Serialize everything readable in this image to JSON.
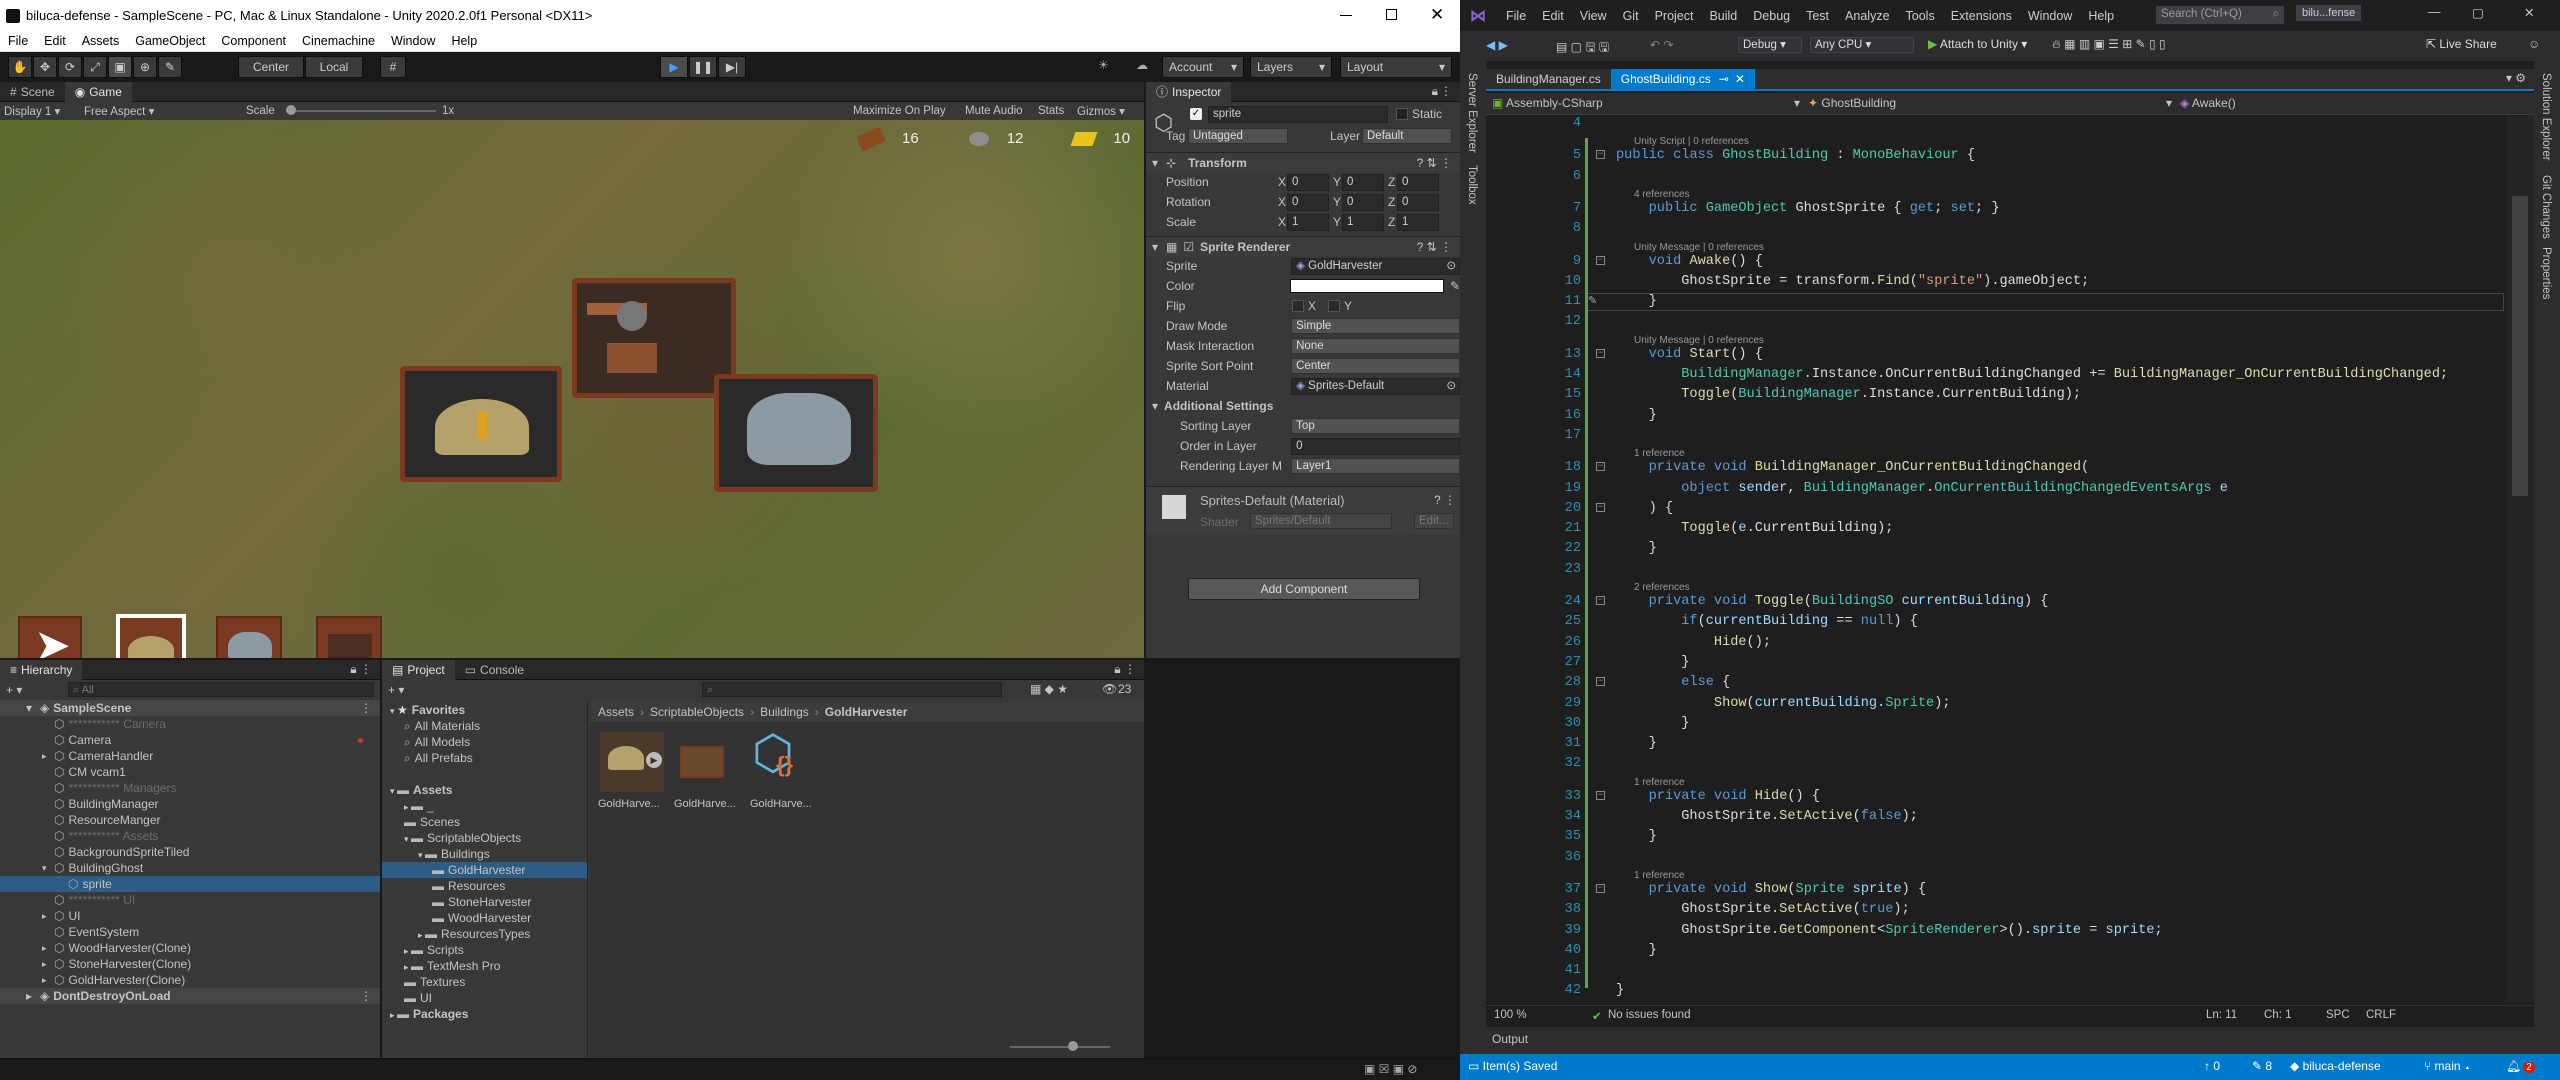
{
  "unity": {
    "window_title": "biluca-defense - SampleScene - PC, Mac & Linux Standalone - Unity 2020.2.0f1 Personal <DX11>",
    "menu": [
      "File",
      "Edit",
      "Assets",
      "GameObject",
      "Component",
      "Cinemachine",
      "Window",
      "Help"
    ],
    "toolbar": {
      "center": "Center",
      "local": "Local",
      "account": "Account",
      "layers": "Layers",
      "layout": "Layout"
    },
    "scene_tabs": [
      "Scene",
      "Game"
    ],
    "game_bar": {
      "display": "Display 1",
      "aspect": "Free Aspect",
      "scale_label": "Scale",
      "scale_value": "1x",
      "maximize": "Maximize On Play",
      "mute": "Mute Audio",
      "stats": "Stats",
      "gizmos": "Gizmos"
    },
    "resources": {
      "wood": "16",
      "stone": "12",
      "gold": "10"
    },
    "inspector": {
      "tab": "Inspector",
      "name": "sprite",
      "static": "Static",
      "tag_label": "Tag",
      "tag": "Untagged",
      "layer_label": "Layer",
      "layer": "Default",
      "transform": {
        "title": "Transform",
        "position": "Position",
        "rotation": "Rotation",
        "scale": "Scale",
        "pos": [
          "0",
          "0",
          "0"
        ],
        "rot": [
          "0",
          "0",
          "0"
        ],
        "scl": [
          "1",
          "1",
          "1"
        ]
      },
      "sprite_renderer": {
        "title": "Sprite Renderer",
        "rows": [
          {
            "label": "Sprite",
            "value": "GoldHarvester"
          },
          {
            "label": "Color",
            "value": ""
          },
          {
            "label": "Flip",
            "value": ""
          },
          {
            "label": "Draw Mode",
            "value": "Simple"
          },
          {
            "label": "Mask Interaction",
            "value": "None"
          },
          {
            "label": "Sprite Sort Point",
            "value": "Center"
          },
          {
            "label": "Material",
            "value": "Sprites-Default"
          }
        ],
        "flip_x": "X",
        "flip_y": "Y",
        "additional": "Additional Settings",
        "sorting_layer_label": "Sorting Layer",
        "sorting_layer": "Top",
        "order_label": "Order in Layer",
        "order": "0",
        "rendering_label": "Rendering Layer M",
        "rendering": "Layer1"
      },
      "material": {
        "name": "Sprites-Default (Material)",
        "shader_label": "Shader",
        "shader": "Sprites/Default",
        "edit": "Edit..."
      },
      "add_component": "Add Component"
    },
    "hierarchy": {
      "tab": "Hierarchy",
      "search": "All",
      "items": [
        {
          "label": "SampleScene",
          "indent": 0,
          "kind": "scene"
        },
        {
          "label": "*********** Camera",
          "indent": 1,
          "kind": "dim"
        },
        {
          "label": "Camera",
          "indent": 1,
          "kind": "obj"
        },
        {
          "label": "CameraHandler",
          "indent": 1,
          "kind": "obj"
        },
        {
          "label": "CM vcam1",
          "indent": 1,
          "kind": "obj"
        },
        {
          "label": "*********** Managers",
          "indent": 1,
          "kind": "dim"
        },
        {
          "label": "BuildingManager",
          "indent": 1,
          "kind": "obj"
        },
        {
          "label": "ResourceManger",
          "indent": 1,
          "kind": "obj"
        },
        {
          "label": "*********** Assets",
          "indent": 1,
          "kind": "dim"
        },
        {
          "label": "BackgroundSpriteTiled",
          "indent": 1,
          "kind": "obj"
        },
        {
          "label": "BuildingGhost",
          "indent": 1,
          "kind": "obj"
        },
        {
          "label": "sprite",
          "indent": 2,
          "kind": "sel"
        },
        {
          "label": "*********** UI",
          "indent": 1,
          "kind": "dim"
        },
        {
          "label": "UI",
          "indent": 1,
          "kind": "obj"
        },
        {
          "label": "EventSystem",
          "indent": 1,
          "kind": "obj"
        },
        {
          "label": "WoodHarvester(Clone)",
          "indent": 1,
          "kind": "obj"
        },
        {
          "label": "StoneHarvester(Clone)",
          "indent": 1,
          "kind": "obj"
        },
        {
          "label": "GoldHarvester(Clone)",
          "indent": 1,
          "kind": "obj"
        },
        {
          "label": "DontDestroyOnLoad",
          "indent": 0,
          "kind": "scene"
        }
      ]
    },
    "project": {
      "tabs": [
        "Project",
        "Console"
      ],
      "count": "23",
      "breadcrumb": [
        "Assets",
        "ScriptableObjects",
        "Buildings",
        "GoldHarvester"
      ],
      "tree": [
        {
          "label": "Favorites",
          "indent": 0,
          "bold": true
        },
        {
          "label": "All Materials",
          "indent": 1
        },
        {
          "label": "All Models",
          "indent": 1
        },
        {
          "label": "All Prefabs",
          "indent": 1
        },
        {
          "label": "",
          "indent": 0
        },
        {
          "label": "Assets",
          "indent": 0,
          "bold": true
        },
        {
          "label": "_",
          "indent": 1
        },
        {
          "label": "Scenes",
          "indent": 1
        },
        {
          "label": "ScriptableObjects",
          "indent": 1
        },
        {
          "label": "Buildings",
          "indent": 2
        },
        {
          "label": "GoldHarvester",
          "indent": 3,
          "sel": true
        },
        {
          "label": "Resources",
          "indent": 3
        },
        {
          "label": "StoneHarvester",
          "indent": 3
        },
        {
          "label": "WoodHarvester",
          "indent": 3
        },
        {
          "label": "ResourcesTypes",
          "indent": 2
        },
        {
          "label": "Scripts",
          "indent": 1
        },
        {
          "label": "TextMesh Pro",
          "indent": 1
        },
        {
          "label": "Textures",
          "indent": 1
        },
        {
          "label": "UI",
          "indent": 1
        },
        {
          "label": "Packages",
          "indent": 0,
          "bold": true
        }
      ],
      "assets": [
        "GoldHarve...",
        "GoldHarve...",
        "GoldHarve..."
      ]
    }
  },
  "vs": {
    "menu": [
      "File",
      "Edit",
      "View",
      "Git",
      "Project",
      "Build",
      "Debug",
      "Test",
      "Analyze",
      "Tools",
      "Extensions",
      "Window",
      "Help"
    ],
    "search": "Search (Ctrl+Q)",
    "solution": "bilu...fense",
    "config": "Debug",
    "platform": "Any CPU",
    "attach": "Attach to Unity",
    "live_share": "Live Share",
    "tabs": [
      "BuildingManager.cs",
      "GhostBuilding.cs"
    ],
    "side_tabs": [
      "Server Explorer",
      "Toolbox"
    ],
    "right_tabs": [
      "Solution Explorer",
      "Git Changes",
      "Properties"
    ],
    "nav": {
      "project": "Assembly-CSharp",
      "class": "GhostBuilding",
      "member": "Awake()"
    },
    "lines": [
      {
        "n": "4",
        "t": ""
      },
      {
        "n": "",
        "t": "Unity Script | 0 references",
        "meta": true
      },
      {
        "n": "5",
        "t": "public class GhostBuilding : MonoBehaviour {"
      },
      {
        "n": "6",
        "t": ""
      },
      {
        "n": "",
        "t": "4 references",
        "meta": true
      },
      {
        "n": "7",
        "t": "    public GameObject GhostSprite { get; set; }"
      },
      {
        "n": "8",
        "t": ""
      },
      {
        "n": "",
        "t": "Unity Message | 0 references",
        "meta": true
      },
      {
        "n": "9",
        "t": "    void Awake() {"
      },
      {
        "n": "10",
        "t": "        GhostSprite = transform.Find(\"sprite\").gameObject;"
      },
      {
        "n": "11",
        "t": "    }"
      },
      {
        "n": "12",
        "t": ""
      },
      {
        "n": "",
        "t": "Unity Message | 0 references",
        "meta": true
      },
      {
        "n": "13",
        "t": "    void Start() {"
      },
      {
        "n": "14",
        "t": "        BuildingManager.Instance.OnCurrentBuildingChanged += BuildingManager_OnCurrentBuildingChanged;"
      },
      {
        "n": "15",
        "t": "        Toggle(BuildingManager.Instance.CurrentBuilding);"
      },
      {
        "n": "16",
        "t": "    }"
      },
      {
        "n": "17",
        "t": ""
      },
      {
        "n": "",
        "t": "1 reference",
        "meta": true
      },
      {
        "n": "18",
        "t": "    private void BuildingManager_OnCurrentBuildingChanged("
      },
      {
        "n": "19",
        "t": "        object sender, BuildingManager.OnCurrentBuildingChangedEventsArgs e"
      },
      {
        "n": "20",
        "t": "    ) {"
      },
      {
        "n": "21",
        "t": "        Toggle(e.CurrentBuilding);"
      },
      {
        "n": "22",
        "t": "    }"
      },
      {
        "n": "23",
        "t": ""
      },
      {
        "n": "",
        "t": "2 references",
        "meta": true
      },
      {
        "n": "24",
        "t": "    private void Toggle(BuildingSO currentBuilding) {"
      },
      {
        "n": "25",
        "t": "        if(currentBuilding == null) {"
      },
      {
        "n": "26",
        "t": "            Hide();"
      },
      {
        "n": "27",
        "t": "        }"
      },
      {
        "n": "28",
        "t": "        else {"
      },
      {
        "n": "29",
        "t": "            Show(currentBuilding.Sprite);"
      },
      {
        "n": "30",
        "t": "        }"
      },
      {
        "n": "31",
        "t": "    }"
      },
      {
        "n": "32",
        "t": ""
      },
      {
        "n": "",
        "t": "1 reference",
        "meta": true
      },
      {
        "n": "33",
        "t": "    private void Hide() {"
      },
      {
        "n": "34",
        "t": "        GhostSprite.SetActive(false);"
      },
      {
        "n": "35",
        "t": "    }"
      },
      {
        "n": "36",
        "t": ""
      },
      {
        "n": "",
        "t": "1 reference",
        "meta": true
      },
      {
        "n": "37",
        "t": "    private void Show(Sprite sprite) {"
      },
      {
        "n": "38",
        "t": "        GhostSprite.SetActive(true);"
      },
      {
        "n": "39",
        "t": "        GhostSprite.GetComponent<SpriteRenderer>().sprite = sprite;"
      },
      {
        "n": "40",
        "t": "    }"
      },
      {
        "n": "41",
        "t": ""
      },
      {
        "n": "42",
        "t": "}"
      }
    ],
    "editor_status": {
      "zoom": "100 %",
      "issues": "No issues found",
      "ln": "Ln: 11",
      "ch": "Ch: 1",
      "spc": "SPC",
      "crlf": "CRLF"
    },
    "output": "Output",
    "status": {
      "saved": "Item(s) Saved",
      "up": "0",
      "pencil": "8",
      "repo": "biluca-defense",
      "branch": "main",
      "errors": "2"
    }
  }
}
